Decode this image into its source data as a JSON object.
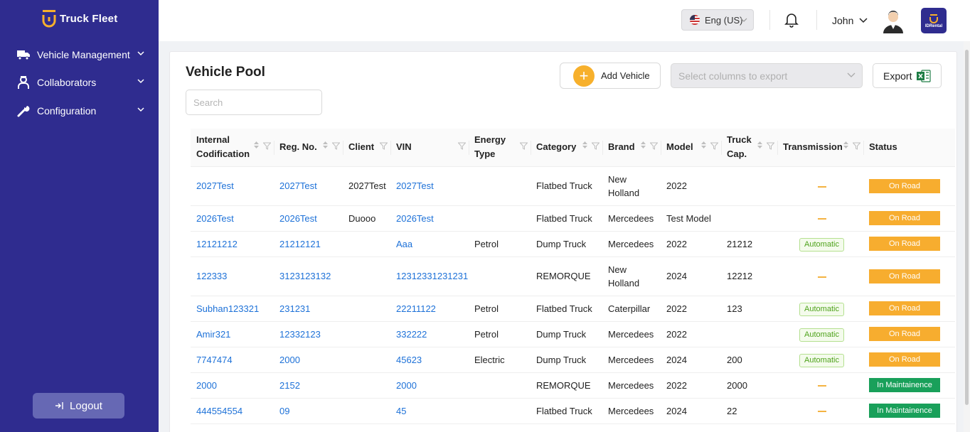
{
  "sidebar": {
    "brand": "Truck Fleet",
    "items": [
      {
        "label": "Vehicle Management",
        "icon": "truck-icon"
      },
      {
        "label": "Collaborators",
        "icon": "person-icon"
      },
      {
        "label": "Configuration",
        "icon": "wrench-icon"
      }
    ],
    "logout_label": "Logout"
  },
  "topbar": {
    "language": "Eng (US)",
    "user_name": "John",
    "partner_logo_text": "IDRental"
  },
  "page": {
    "title": "Vehicle Pool",
    "search_placeholder": "Search",
    "add_vehicle_label": "Add Vehicle",
    "export_columns_placeholder": "Select columns to export",
    "export_label": "Export"
  },
  "table": {
    "columns": [
      "Internal Codification",
      "Reg. No.",
      "Client",
      "VIN",
      "Energy Type",
      "Category",
      "Brand",
      "Model",
      "Truck Cap.",
      "Transmission",
      "Status"
    ],
    "rows": [
      {
        "internal": "2027Test",
        "reg": "2027Test",
        "client": "2027Test",
        "vin": "2027Test",
        "energy": "",
        "category": "Flatbed Truck",
        "brand": "New Holland",
        "model": "2022",
        "cap": "",
        "transmission": "",
        "status": "On Road"
      },
      {
        "internal": "2026Test",
        "reg": "2026Test",
        "client": "Duooo",
        "vin": "2026Test",
        "energy": "",
        "category": "Flatbed Truck",
        "brand": "Mercedees",
        "model": "Test Model",
        "cap": "",
        "transmission": "",
        "status": "On Road"
      },
      {
        "internal": "12121212",
        "reg": "21212121",
        "client": "",
        "vin": "Aaa",
        "energy": "Petrol",
        "category": "Dump Truck",
        "brand": "Mercedees",
        "model": "2022",
        "cap": "21212",
        "transmission": "Automatic",
        "status": "On Road"
      },
      {
        "internal": "122333",
        "reg": "3123123132",
        "client": "",
        "vin": "12312331231231",
        "energy": "",
        "category": "REMORQUE",
        "brand": "New Holland",
        "model": "2024",
        "cap": "12212",
        "transmission": "",
        "status": "On Road"
      },
      {
        "internal": "Subhan123321",
        "reg": "231231",
        "client": "",
        "vin": "22211122",
        "energy": "Petrol",
        "category": "Flatbed Truck",
        "brand": "Caterpillar",
        "model": "2022",
        "cap": "123",
        "transmission": "Automatic",
        "status": "On Road"
      },
      {
        "internal": "Amir321",
        "reg": "12332123",
        "client": "",
        "vin": "332222",
        "energy": "Petrol",
        "category": "Dump Truck",
        "brand": "Mercedees",
        "model": "2022",
        "cap": "",
        "transmission": "Automatic",
        "status": "On Road"
      },
      {
        "internal": "7747474",
        "reg": "2000",
        "client": "",
        "vin": "45623",
        "energy": "Electric",
        "category": "Dump Truck",
        "brand": "Mercedees",
        "model": "2024",
        "cap": "200",
        "transmission": "Automatic",
        "status": "On Road"
      },
      {
        "internal": "2000",
        "reg": "2152",
        "client": "",
        "vin": "2000",
        "energy": "",
        "category": "REMORQUE",
        "brand": "Mercedees",
        "model": "2022",
        "cap": "2000",
        "transmission": "",
        "status": "In Maintainence"
      },
      {
        "internal": "444554554",
        "reg": "09",
        "client": "",
        "vin": "45",
        "energy": "",
        "category": "Flatbed Truck",
        "brand": "Mercedees",
        "model": "2024",
        "cap": "22",
        "transmission": "",
        "status": "In Maintainence"
      }
    ]
  },
  "colors": {
    "sidebar_bg": "#2f2c8f",
    "accent": "#f7b02c",
    "link": "#1d71d8",
    "status_on_road": "#f7ad2f",
    "status_maintenance": "#19a05a"
  }
}
